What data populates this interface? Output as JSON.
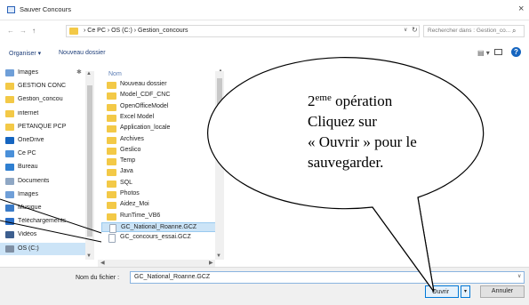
{
  "window": {
    "title": "Sauver Concours",
    "close_glyph": "×"
  },
  "nav_buttons": {
    "back": "←",
    "forward": "→",
    "up": "↑"
  },
  "address_bar": {
    "crumbs": "›  Ce PC  ›  OS (C:)  ›  Gestion_concours",
    "dropdown_glyph": "∨",
    "refresh_glyph": "↻"
  },
  "search": {
    "placeholder": "Rechercher dans : Gestion_co...",
    "icon": "search-icon"
  },
  "toolbar": {
    "organiser": "Organiser ▾",
    "new_folder": "Nouveau dossier",
    "view_glyph": "▤ ▾",
    "help_glyph": "?"
  },
  "nav_pane": {
    "items": [
      {
        "label": "Images",
        "icon": "pictures-icon",
        "pinned": true
      },
      {
        "label": "GESTION CONC",
        "icon": "folder-icon"
      },
      {
        "label": "Gestion_concou",
        "icon": "folder-icon"
      },
      {
        "label": "internet",
        "icon": "folder-icon"
      },
      {
        "label": "PETANQUE PCP",
        "icon": "folder-icon"
      },
      {
        "label": "OneDrive",
        "icon": "cloud-icon"
      },
      {
        "label": "Ce PC",
        "icon": "computer-icon"
      },
      {
        "label": "Bureau",
        "icon": "desktop-icon"
      },
      {
        "label": "Documents",
        "icon": "documents-icon"
      },
      {
        "label": "Images",
        "icon": "pictures-icon"
      },
      {
        "label": "Musique",
        "icon": "music-icon"
      },
      {
        "label": "Téléchargements",
        "icon": "download-icon"
      },
      {
        "label": "Vidéos",
        "icon": "video-icon"
      },
      {
        "label": "OS (C:)",
        "icon": "drive-icon",
        "selected": true
      }
    ],
    "pin_glyph": "✱"
  },
  "file_list": {
    "column_header": "Nom",
    "items": [
      {
        "name": "Nouveau dossier",
        "type": "folder"
      },
      {
        "name": "Model_CDF_CNC",
        "type": "folder"
      },
      {
        "name": "OpenOfficeModel",
        "type": "folder"
      },
      {
        "name": "Excel Model",
        "type": "folder"
      },
      {
        "name": "Application_locale",
        "type": "folder"
      },
      {
        "name": "Archives",
        "type": "folder"
      },
      {
        "name": "Geslico",
        "type": "folder"
      },
      {
        "name": "Temp",
        "type": "folder"
      },
      {
        "name": "Java",
        "type": "folder"
      },
      {
        "name": "SQL",
        "type": "folder"
      },
      {
        "name": "Photos",
        "type": "folder"
      },
      {
        "name": "Aidez_Moi",
        "type": "folder"
      },
      {
        "name": "RunTime_VB6",
        "type": "folder"
      },
      {
        "name": "GC_National_Roanne.GCZ",
        "type": "file",
        "selected": true
      },
      {
        "name": "GC_concours_essai.GCZ",
        "type": "file"
      }
    ]
  },
  "filename": {
    "label": "Nom du fichier :",
    "value": "GC_National_Roanne.GCZ"
  },
  "buttons": {
    "open": "Ouvrir",
    "open_dropdown": "▾",
    "cancel": "Annuler"
  },
  "callout": {
    "prefix": "2",
    "superscript": "eme",
    "line1_rest": " opération",
    "line2": "Cliquez sur",
    "line3": "« Ouvrir » pour le",
    "line4": "sauvegarder."
  },
  "colors": {
    "accent": "#0078d7",
    "selection": "#cce4f7",
    "folder": "#f3c947",
    "link": "#1f3f7a"
  }
}
